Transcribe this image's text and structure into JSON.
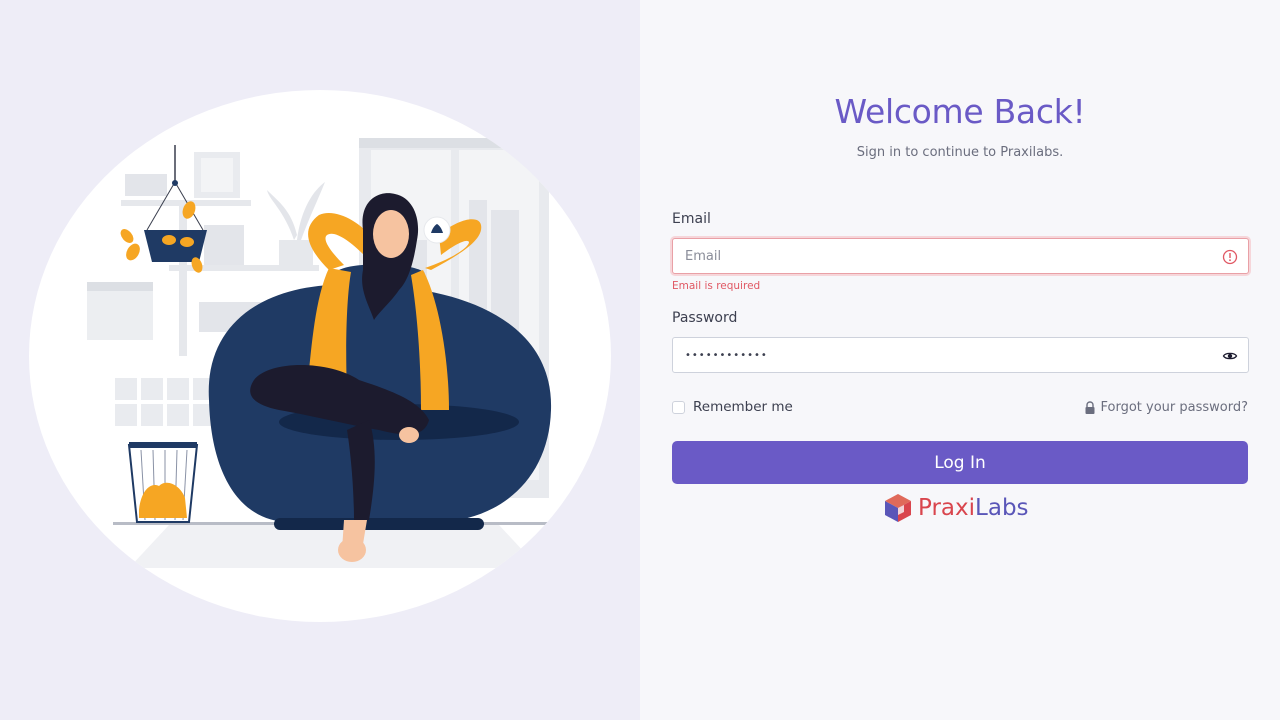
{
  "header": {
    "title": "Welcome Back!",
    "subtitle": "Sign in to continue to Praxilabs."
  },
  "form": {
    "email": {
      "label": "Email",
      "placeholder": "Email",
      "value": "",
      "error": "Email is required",
      "status_icon": "error-circle-icon"
    },
    "password": {
      "label": "Password",
      "value": "••••••••••••",
      "toggle_icon": "eye-icon"
    },
    "remember": {
      "label": "Remember me",
      "checked": false
    },
    "forgot": {
      "label": "Forgot your password?",
      "icon": "lock-icon"
    },
    "submit_label": "Log In"
  },
  "brand": {
    "logo_part1": "Praxi",
    "logo_part2": "Labs",
    "accent_color": "#6a5ac6",
    "error_color": "#e05864"
  },
  "illustration": {
    "description_icon": "woman-relaxing-in-beanbag-illustration"
  }
}
